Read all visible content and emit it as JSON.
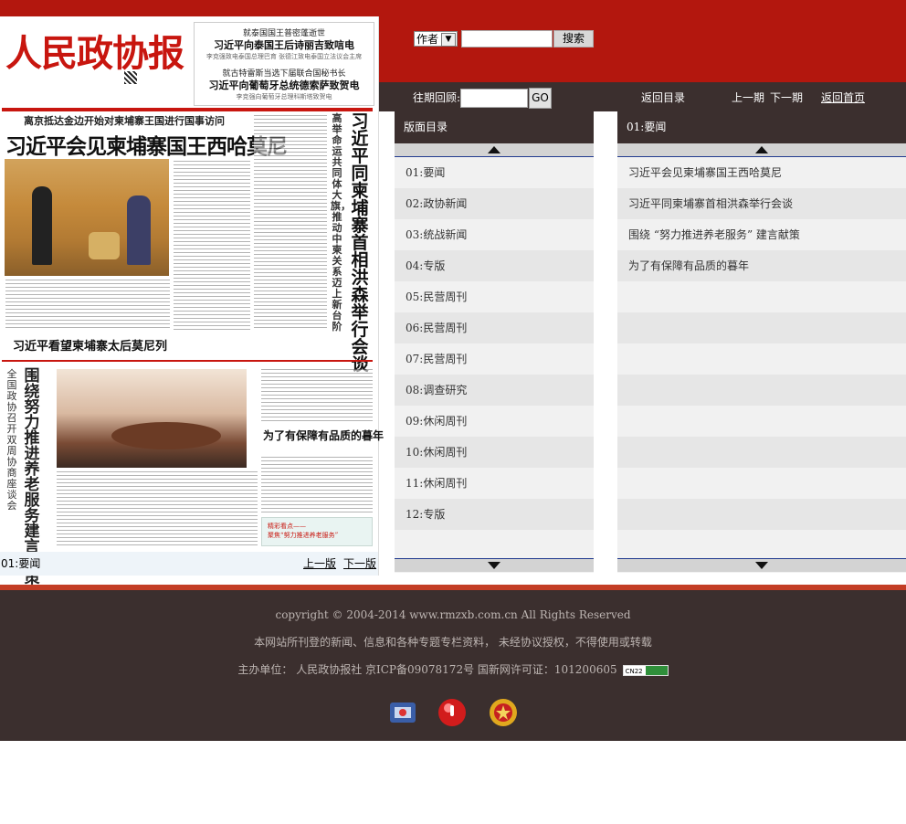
{
  "search": {
    "field_selected": "作者",
    "button_label": "搜索"
  },
  "nav": {
    "past_label": "往期回顾:",
    "go_label": "GO",
    "back_toc": "返回目录",
    "prev_issue": "上一期",
    "next_issue": "下一期",
    "home": "返回首页"
  },
  "newspaper": {
    "masthead": "人民政协报",
    "box_kicker1": "就泰国国王普密蓬逝世",
    "box_head1": "习近平向泰国王后诗丽吉致唁电",
    "box_note1": "李克强致电泰国总理巴育 张德江致电泰国立法议会主席",
    "box_kicker2": "就古特雷斯当选下届联合国秘书长",
    "box_head2": "习近平向葡萄牙总统德索萨致贺电",
    "box_note2": "李克强向葡萄牙总理科斯塔致贺电",
    "lead_kicker": "离京抵达金边开始对柬埔寨王国进行国事访问",
    "lead_headline": "习近平会见柬埔寨国王西哈莫尼",
    "vertical_headline": "习近平同柬埔寨首相洪森举行会谈",
    "vertical_kicker": "高举命运共同体大旗，推动中柬关系迈上新台阶",
    "sub_headline": "习近平看望柬埔寨太后莫尼列",
    "bottom_vertical": "围绕努力推进养老服务建言献策",
    "bottom_vertical_small": "全国政协召开双周协商座谈会",
    "bottom_right_head": "为了有保障有品质的暮年",
    "ad_text1": "精彩看点——",
    "ad_text2": "聚焦“努力推进养老服务”"
  },
  "page_bar": {
    "current": "01:要闻",
    "prev_page": "上一版",
    "next_page": "下一版"
  },
  "toc_panel": {
    "title": "版面目录",
    "items": [
      "01:要闻",
      "02:政协新闻",
      "03:统战新闻",
      "04:专版",
      "05:民营周刊",
      "06:民营周刊",
      "07:民营周刊",
      "08:调查研究",
      "09:休闲周刊",
      "10:休闲周刊",
      "11:休闲周刊",
      "12:专版"
    ]
  },
  "article_panel": {
    "title": "01:要闻",
    "items": [
      "习近平会见柬埔寨国王西哈莫尼",
      "习近平同柬埔寨首相洪森举行会谈",
      "围绕 “努力推进养老服务” 建言献策",
      "为了有保障有品质的暮年"
    ]
  },
  "footer": {
    "copyright": "copyright © 2004-2014 www.rmzxb.com.cn All Rights Reserved",
    "notice": "本网站所刊登的新闻、信息和各种专题专栏资料，  未经协议授权，不得使用或转载",
    "sponsor": "主办单位：  人民政协报社  京ICP备09078172号  国新网许可证：101200605",
    "cnnic_badge": "CN22"
  },
  "colors": {
    "header_red": "#b3170e",
    "dark_bar": "#3b2f2e",
    "footer_accent": "#c33d25"
  }
}
